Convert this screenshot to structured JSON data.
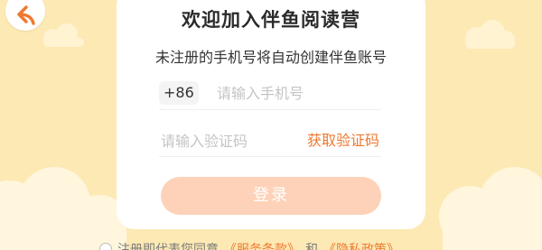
{
  "colors": {
    "background": "#fde9b4",
    "card": "#ffffff",
    "accent": "#f0792f",
    "login_button_bg": "#fdd2b8"
  },
  "header": {
    "back_icon": "back-arrow-icon"
  },
  "card": {
    "title": "欢迎加入伴鱼阅读营",
    "subtitle": "未注册的手机号将自动创建伴鱼账号"
  },
  "phone": {
    "prefix": "+86",
    "placeholder": "请输入手机号"
  },
  "code": {
    "placeholder": "请输入验证码",
    "get_code_label": "获取验证码"
  },
  "login": {
    "label": "登录"
  },
  "agreement": {
    "text": "注册即代表您同意",
    "user_agreement": "《服务条款》",
    "and": "和",
    "privacy_policy": "《隐私政策》"
  }
}
